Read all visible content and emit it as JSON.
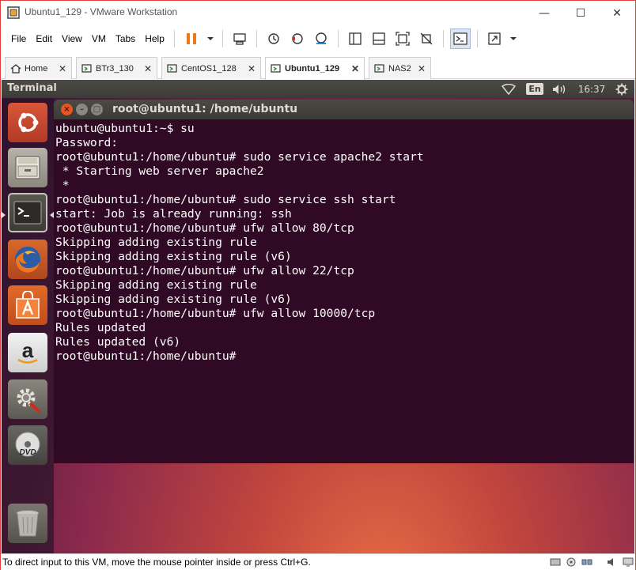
{
  "window": {
    "title": "Ubuntu1_129 - VMware Workstation",
    "controls": {
      "minimize": "—",
      "maximize": "☐",
      "close": "✕"
    }
  },
  "menu": {
    "items": [
      "File",
      "Edit",
      "View",
      "VM",
      "Tabs",
      "Help"
    ]
  },
  "tabs": [
    {
      "label": "Home",
      "icon": "home-icon"
    },
    {
      "label": "BTr3_130",
      "icon": "vm-icon"
    },
    {
      "label": "CentOS1_128",
      "icon": "vm-icon"
    },
    {
      "label": "Ubuntu1_129",
      "icon": "vm-icon",
      "active": true
    },
    {
      "label": "NAS2",
      "icon": "vm-icon"
    }
  ],
  "ubuntu": {
    "topbar": {
      "app_name": "Terminal",
      "lang": "En",
      "time": "16:37"
    },
    "terminal": {
      "title": "root@ubuntu1: /home/ubuntu",
      "lines": [
        "ubuntu@ubuntu1:~$ su",
        "Password:",
        "root@ubuntu1:/home/ubuntu# sudo service apache2 start",
        " * Starting web server apache2",
        " *",
        "root@ubuntu1:/home/ubuntu# sudo service ssh start",
        "start: Job is already running: ssh",
        "root@ubuntu1:/home/ubuntu# ufw allow 80/tcp",
        "Skipping adding existing rule",
        "Skipping adding existing rule (v6)",
        "root@ubuntu1:/home/ubuntu# ufw allow 22/tcp",
        "Skipping adding existing rule",
        "Skipping adding existing rule (v6)",
        "root@ubuntu1:/home/ubuntu# ufw allow 10000/tcp",
        "Rules updated",
        "Rules updated (v6)",
        "root@ubuntu1:/home/ubuntu#"
      ]
    },
    "launcher": [
      {
        "name": "ubuntu-dash-icon"
      },
      {
        "name": "files-icon"
      },
      {
        "name": "terminal-icon",
        "active": true
      },
      {
        "name": "firefox-icon"
      },
      {
        "name": "software-center-icon"
      },
      {
        "name": "amazon-icon"
      },
      {
        "name": "system-settings-icon"
      },
      {
        "name": "dvd-icon"
      },
      {
        "name": "trash-icon"
      }
    ]
  },
  "status": {
    "text": "To direct input to this VM, move the mouse pointer inside or press Ctrl+G."
  },
  "colors": {
    "terminal_bg": "#300a24",
    "accent_orange": "#e95420",
    "frame_red": "#e04040"
  }
}
